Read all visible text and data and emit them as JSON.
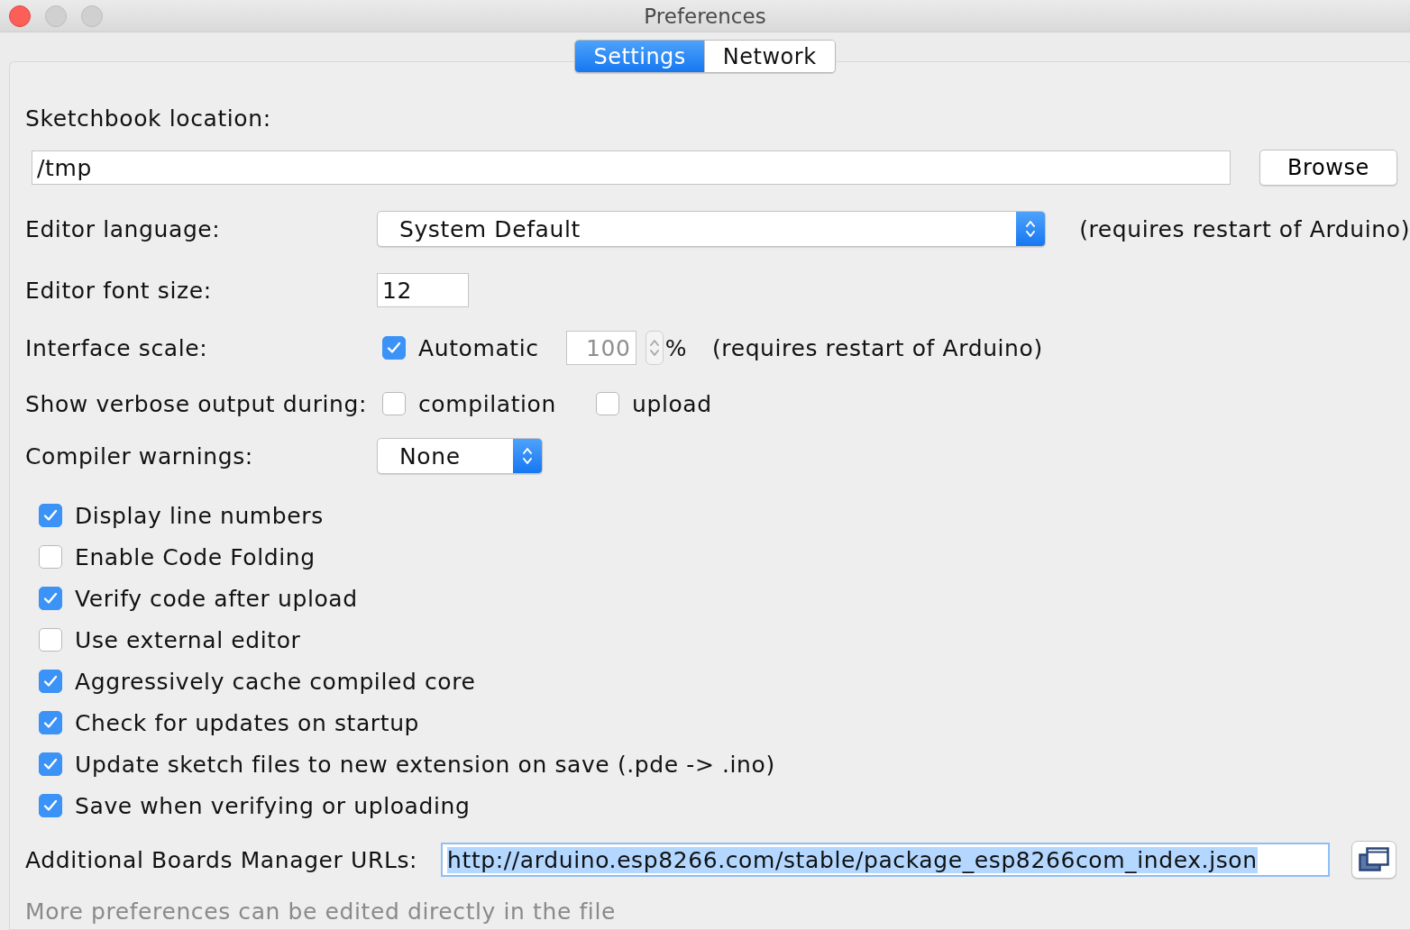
{
  "window": {
    "title": "Preferences"
  },
  "tabs": [
    {
      "label": "Settings",
      "selected": true
    },
    {
      "label": "Network",
      "selected": false
    }
  ],
  "sketchbook": {
    "label": "Sketchbook location:",
    "value": "/tmp",
    "button": "Browse"
  },
  "editor_language": {
    "label": "Editor language:",
    "value": "System Default",
    "note": "(requires restart of Arduino)"
  },
  "font_size": {
    "label": "Editor font size:",
    "value": "12"
  },
  "interface_scale": {
    "label": "Interface scale:",
    "automatic": {
      "label": "Automatic",
      "checked": true
    },
    "value": "100",
    "disabled": true,
    "unit": "%",
    "note": "(requires restart of Arduino)"
  },
  "verbose": {
    "label": "Show verbose output during:",
    "options": [
      {
        "label": "compilation",
        "checked": false
      },
      {
        "label": "upload",
        "checked": false
      }
    ]
  },
  "compiler_warnings": {
    "label": "Compiler warnings:",
    "value": "None"
  },
  "options": [
    {
      "label": "Display line numbers",
      "checked": true
    },
    {
      "label": "Enable Code Folding",
      "checked": false
    },
    {
      "label": "Verify code after upload",
      "checked": true
    },
    {
      "label": "Use external editor",
      "checked": false
    },
    {
      "label": "Aggressively cache compiled core",
      "checked": true
    },
    {
      "label": "Check for updates on startup",
      "checked": true
    },
    {
      "label": "Update sketch files to new extension on save (.pde -> .ino)",
      "checked": true
    },
    {
      "label": "Save when verifying or uploading",
      "checked": true
    }
  ],
  "boards_urls": {
    "label": "Additional Boards Manager URLs:",
    "value": "http://arduino.esp8266.com/stable/package_esp8266com_index.json",
    "text_selected": true
  },
  "footer": "More preferences can be edited directly in the file"
}
